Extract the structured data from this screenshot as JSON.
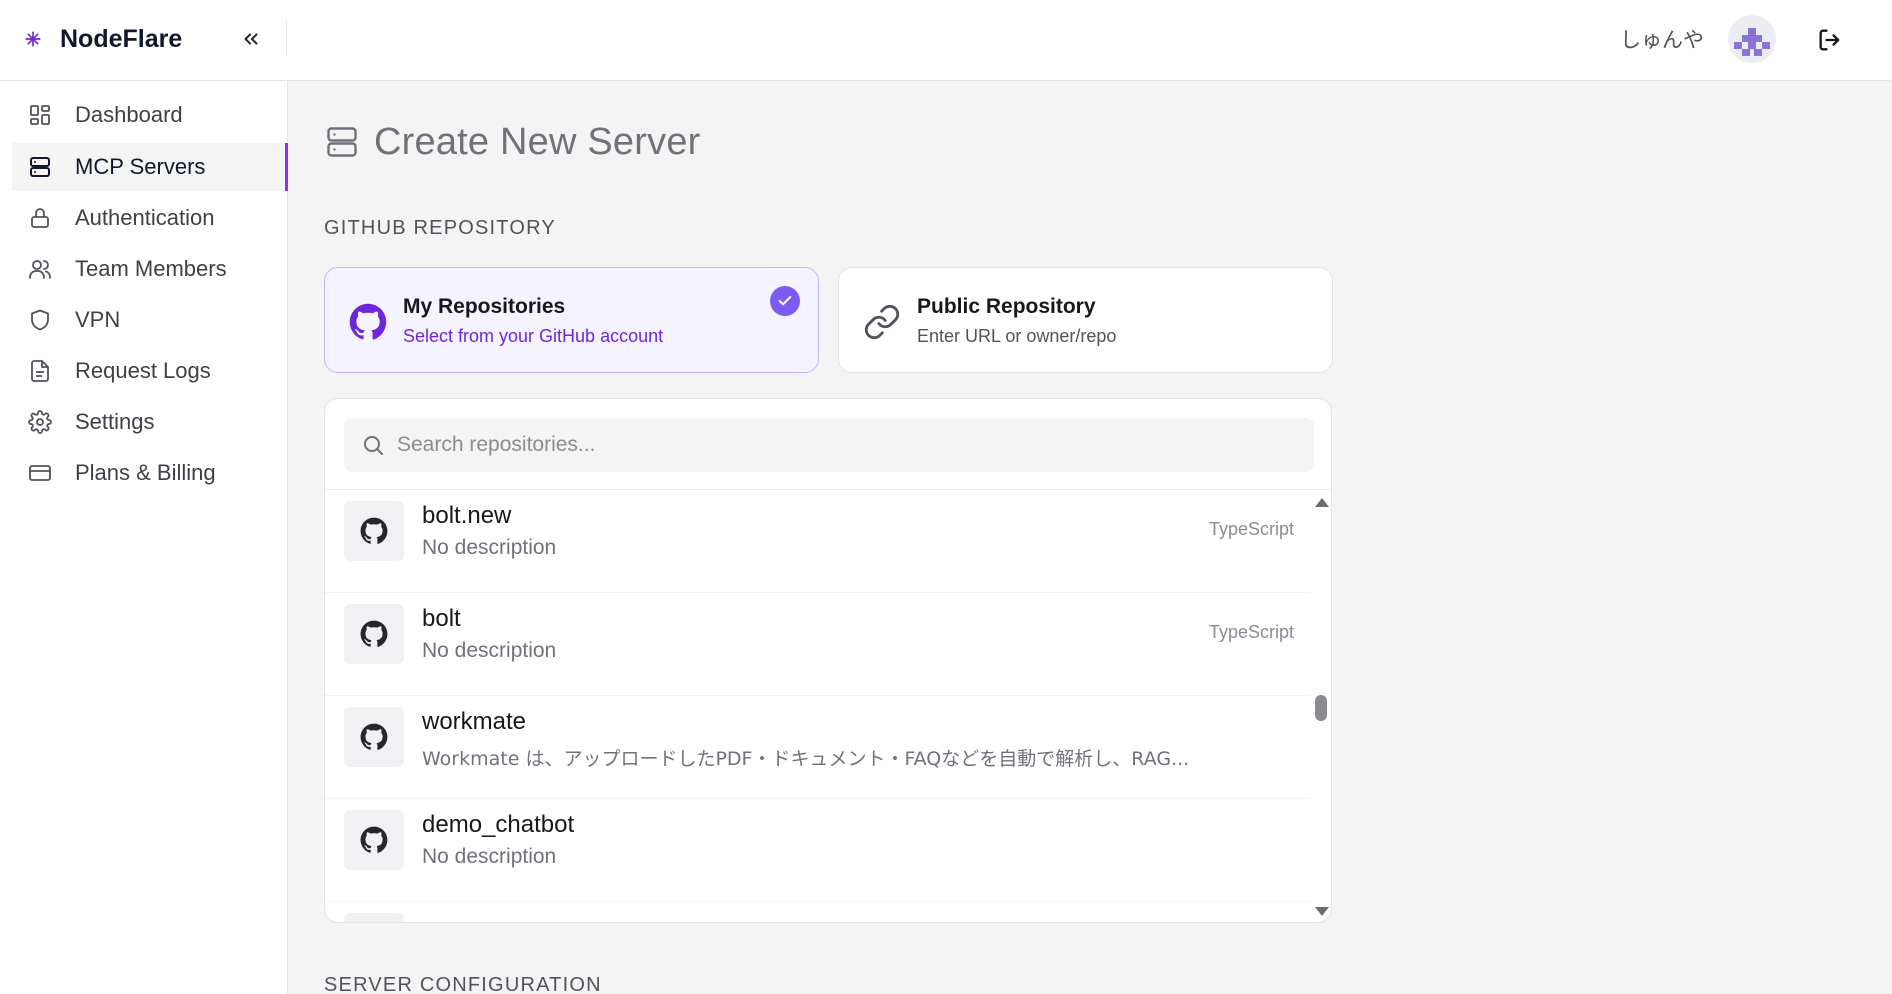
{
  "brand": {
    "name": "NodeFlare",
    "mark_icon": "asterisk-logo-icon",
    "accent": "#7c3aed"
  },
  "header": {
    "user_name": "しゅんや",
    "collapse_icon": "chevrons-left-icon",
    "logout_icon": "logout-icon"
  },
  "sidebar": {
    "items": [
      {
        "label": "Dashboard",
        "icon": "dashboard-icon",
        "active": false
      },
      {
        "label": "MCP Servers",
        "icon": "server-icon",
        "active": true
      },
      {
        "label": "Authentication",
        "icon": "lock-icon",
        "active": false
      },
      {
        "label": "Team Members",
        "icon": "users-icon",
        "active": false
      },
      {
        "label": "VPN",
        "icon": "shield-icon",
        "active": false
      },
      {
        "label": "Request Logs",
        "icon": "file-text-icon",
        "active": false
      },
      {
        "label": "Settings",
        "icon": "gear-icon",
        "active": false
      },
      {
        "label": "Plans & Billing",
        "icon": "credit-card-icon",
        "active": false
      }
    ]
  },
  "main": {
    "title": "Create New Server",
    "github_section_label": "GITHUB REPOSITORY",
    "source_options": [
      {
        "title": "My Repositories",
        "subtitle": "Select from your GitHub account",
        "icon": "github-icon",
        "selected": true
      },
      {
        "title": "Public Repository",
        "subtitle": "Enter URL or owner/repo",
        "icon": "link-icon",
        "selected": false
      }
    ],
    "search": {
      "placeholder": "Search repositories...",
      "value": ""
    },
    "repositories": [
      {
        "name": "bolt.new",
        "description": "No description",
        "language": "TypeScript"
      },
      {
        "name": "bolt",
        "description": "No description",
        "language": "TypeScript"
      },
      {
        "name": "workmate",
        "description": "Workmate は、アップロードしたPDF・ドキュメント・FAQなどを自動で解析し、RAG...",
        "language": ""
      },
      {
        "name": "demo_chatbot",
        "description": "No description",
        "language": ""
      },
      {
        "name": "",
        "description": "",
        "language": ""
      }
    ],
    "config_section_label": "SERVER CONFIGURATION"
  }
}
